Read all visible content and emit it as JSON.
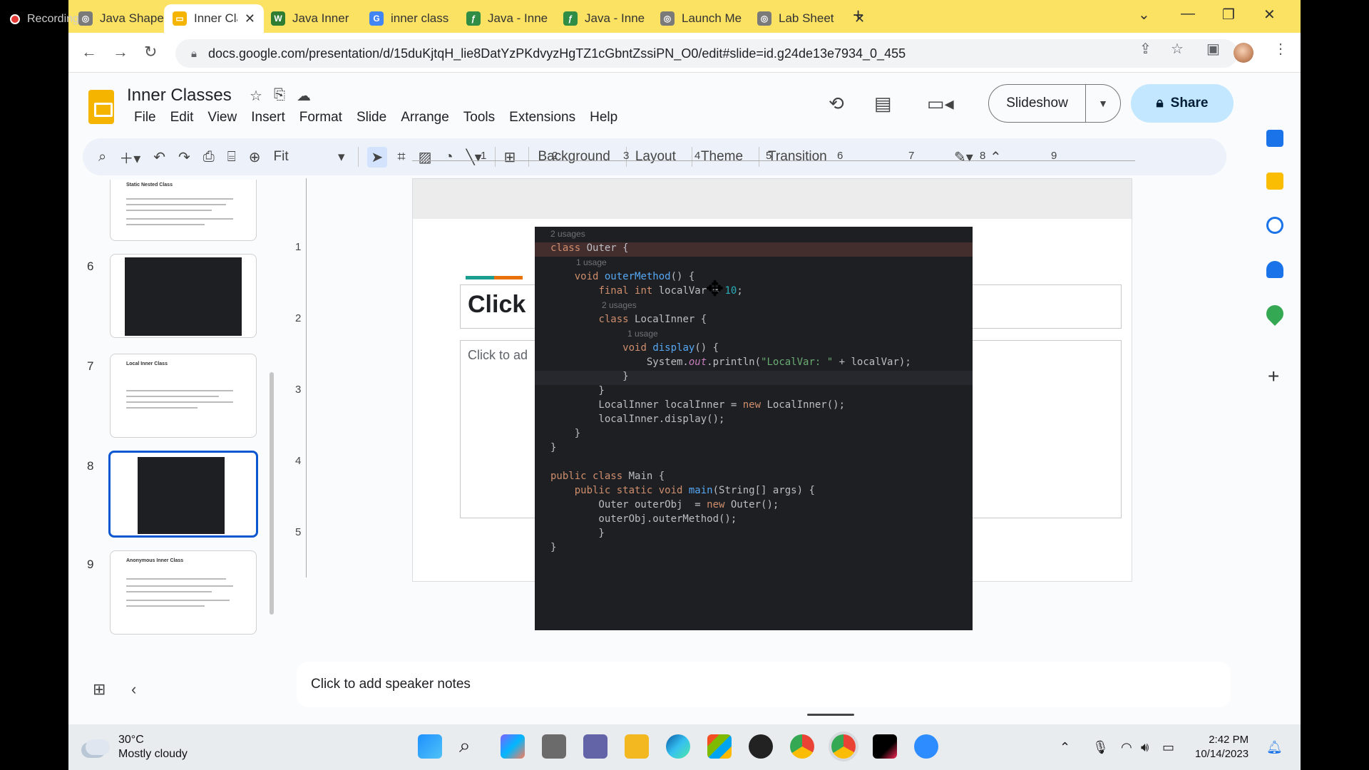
{
  "recording": {
    "label": "Recording"
  },
  "tabs": [
    {
      "title": "Java Shape",
      "fav_color": "#7a7a7a",
      "fav_char": "◎"
    },
    {
      "title": "Inner Class",
      "fav_color": "#f4b400",
      "fav_char": "▭",
      "active": true
    },
    {
      "title": "Java Inner",
      "fav_color": "#2e7d32",
      "fav_char": "W"
    },
    {
      "title": "inner class",
      "fav_color": "#4285f4",
      "fav_char": "G"
    },
    {
      "title": "Java - Inne",
      "fav_color": "#2f8d46",
      "fav_char": "ƒ"
    },
    {
      "title": "Java - Inne",
      "fav_color": "#2f8d46",
      "fav_char": "ƒ"
    },
    {
      "title": "Launch Me",
      "fav_color": "#7a7a7a",
      "fav_char": "◎"
    },
    {
      "title": "Lab Sheet",
      "fav_color": "#7a7a7a",
      "fav_char": "◎"
    }
  ],
  "address": {
    "url": "docs.google.com/presentation/d/15duKjtqH_lie8DatYzPKdvyzHgTZ1cGbntZssiPN_O0/edit#slide=id.g24de13e7934_0_455"
  },
  "doc": {
    "title": "Inner Classes"
  },
  "menu": [
    "File",
    "Edit",
    "View",
    "Insert",
    "Format",
    "Slide",
    "Arrange",
    "Tools",
    "Extensions",
    "Help"
  ],
  "header": {
    "slideshow_label": "Slideshow",
    "share_label": "Share"
  },
  "toolbar": {
    "zoom_value": "Fit",
    "background_label": "Background",
    "layout_label": "Layout",
    "theme_label": "Theme",
    "transition_label": "Transition"
  },
  "filmstrip": {
    "numbers": [
      "6",
      "7",
      "8",
      "9"
    ],
    "titles": {
      "s5": "Static Nested Class",
      "s7": "Local Inner Class",
      "s9": "Anonymous Inner Class"
    }
  },
  "slide": {
    "title_placeholder": "Click",
    "body_placeholder": "Click to ad"
  },
  "ruler": {
    "h": [
      "1",
      "2",
      "3",
      "4",
      "5",
      "6",
      "7",
      "8",
      "9"
    ],
    "v": [
      "1",
      "2",
      "3",
      "4",
      "5"
    ]
  },
  "code": {
    "hint_2usages": "2 usages",
    "hint_1usage": "1 usage",
    "hint_2usages_b": "2 usages",
    "hint_1usage_b": "1 usage"
  },
  "notes": {
    "placeholder": "Click to add speaker notes"
  },
  "taskbar": {
    "temp": "30°C",
    "weather": "Mostly cloudy",
    "time": "2:42 PM",
    "date": "10/14/2023"
  }
}
